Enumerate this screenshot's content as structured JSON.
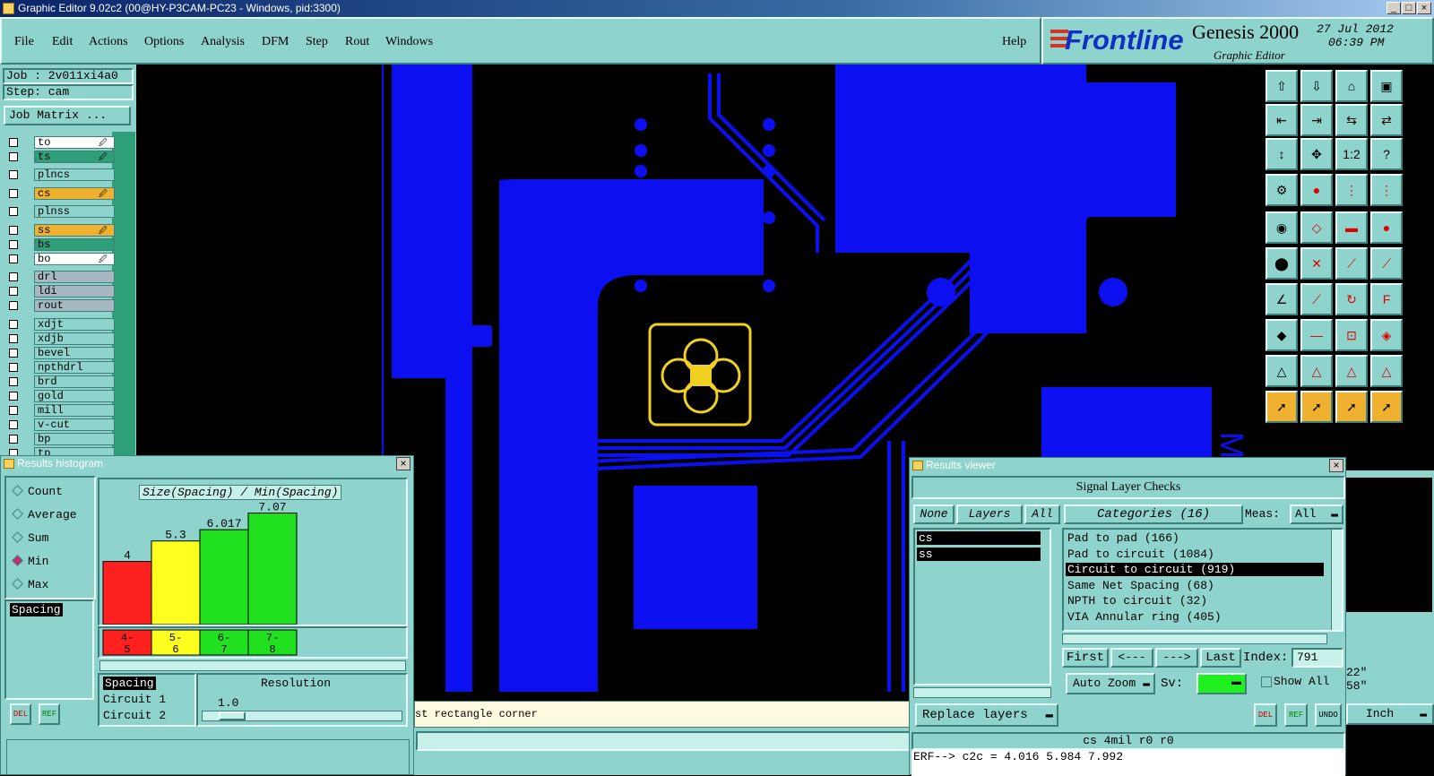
{
  "window": {
    "title": "Graphic Editor 9.02c2 (00@HY-P3CAM-PC23 - Windows, pid:3300)"
  },
  "menu": {
    "items": [
      "File",
      "Edit",
      "Actions",
      "Options",
      "Analysis",
      "DFM",
      "Step",
      "Rout",
      "Windows"
    ],
    "help": "Help"
  },
  "brand": {
    "logo": "Frontline",
    "product": "Genesis 2000",
    "subtitle": "Graphic Editor",
    "date": "27 Jul 2012",
    "time": "06:39 PM"
  },
  "job": {
    "job_label": "Job : 2v011xi4a0",
    "step_label": "Step: cam",
    "matrix_button": "Job Matrix ..."
  },
  "layers": [
    {
      "name": "to",
      "color": "#ffffff",
      "mark": "🖉"
    },
    {
      "name": "ts",
      "color": "#2f9f7a",
      "mark": "🖉"
    },
    {
      "name": "plncs",
      "color": "#8ed4cc",
      "mark": ""
    },
    {
      "name": "cs",
      "color": "#f0b030",
      "mark": "🖉"
    },
    {
      "name": "plnss",
      "color": "#8ed4cc",
      "mark": ""
    },
    {
      "name": "ss",
      "color": "#f0b030",
      "mark": "🖉"
    },
    {
      "name": "bs",
      "color": "#2f9f7a",
      "mark": ""
    },
    {
      "name": "bo",
      "color": "#ffffff",
      "mark": "🖉"
    },
    {
      "name": "drl",
      "color": "#a8b8c0",
      "mark": ""
    },
    {
      "name": "ldi",
      "color": "#a8b8c0",
      "mark": ""
    },
    {
      "name": "rout",
      "color": "#a8b8c0",
      "mark": ""
    },
    {
      "name": "xdjt",
      "color": "#8ed4cc",
      "mark": ""
    },
    {
      "name": "xdjb",
      "color": "#8ed4cc",
      "mark": ""
    },
    {
      "name": "bevel",
      "color": "#8ed4cc",
      "mark": ""
    },
    {
      "name": "npthdrl",
      "color": "#8ed4cc",
      "mark": ""
    },
    {
      "name": "brd",
      "color": "#8ed4cc",
      "mark": ""
    },
    {
      "name": "gold",
      "color": "#8ed4cc",
      "mark": ""
    },
    {
      "name": "mill",
      "color": "#8ed4cc",
      "mark": ""
    },
    {
      "name": "v-cut",
      "color": "#8ed4cc",
      "mark": ""
    },
    {
      "name": "bp",
      "color": "#8ed4cc",
      "mark": ""
    },
    {
      "name": "tp",
      "color": "#8ed4cc",
      "mark": ""
    }
  ],
  "histogram": {
    "title": "Results histogram",
    "modes": [
      "Count",
      "Average",
      "Sum",
      "Min",
      "Max"
    ],
    "selected_mode": "Min",
    "mode_list": [
      "Spacing"
    ],
    "chart_label": "Size(Spacing) / Min(Spacing)",
    "list": [
      "Spacing",
      "Circuit 1",
      "Circuit 2"
    ],
    "resolution_label": "Resolution",
    "resolution_value": "1.0",
    "del": "DEL",
    "ref": "REF"
  },
  "chart_data": {
    "type": "bar",
    "title": "Size(Spacing) / Min(Spacing)",
    "categories": [
      "4-5",
      "5-6",
      "6-7",
      "7-8"
    ],
    "values": [
      4,
      5.3,
      6.017,
      7.07
    ],
    "value_labels": [
      "4",
      "5.3",
      "6.017",
      "7.07"
    ],
    "colors": [
      "#ff2020",
      "#ffff20",
      "#20e020",
      "#20e020"
    ],
    "ylim": [
      0,
      7.5
    ]
  },
  "viewer": {
    "title": "Results viewer",
    "heading": "Signal Layer Checks",
    "none": "None",
    "layers": "Layers",
    "all": "All",
    "categories_label": "Categories (16)",
    "meas_label": "Meas:",
    "meas_value": "All",
    "layer_list": [
      "cs",
      "ss"
    ],
    "category_list": [
      "Pad to pad (166)",
      "Pad to circuit (1084)",
      "Circuit to circuit (919)",
      "Same Net Spacing (68)",
      "NPTH to circuit (32)",
      "VIA Annular ring (405)"
    ],
    "selected_category": "Circuit to circuit (919)",
    "first": "First",
    "prev": "<---",
    "next": "--->",
    "last": "Last",
    "index_label": "Index:",
    "index_value": "791",
    "auto_zoom": "Auto Zoom",
    "sv_label": "Sv:",
    "show_all": "Show All",
    "replace_layers": "Replace layers",
    "status": "cs  4mil  r0  r0",
    "err": "ERF--> c2c = 4.016 5.984 7.992",
    "del": "DEL",
    "ref": "REF",
    "undo": "UNDO"
  },
  "status_bar": {
    "prompt": "st rectangle corner"
  },
  "coords": {
    "line1": "22\"",
    "line2": "58\"",
    "units": "Inch"
  }
}
